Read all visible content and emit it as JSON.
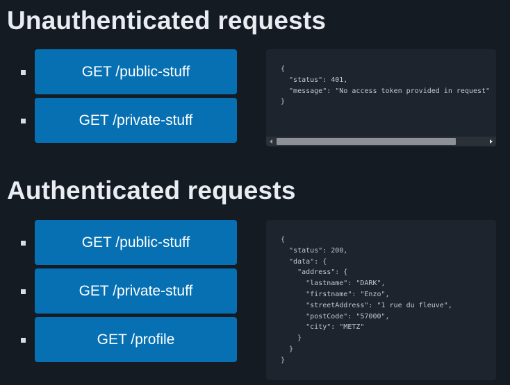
{
  "sections": {
    "unauthenticated": {
      "title": "Unauthenticated requests",
      "buttons": [
        {
          "label": "GET /public-stuff"
        },
        {
          "label": "GET /private-stuff"
        }
      ],
      "response": "{\n  \"status\": 401,\n  \"message\": \"No access token provided in request\"\n}"
    },
    "authenticated": {
      "title": "Authenticated requests",
      "buttons": [
        {
          "label": "GET /public-stuff"
        },
        {
          "label": "GET /private-stuff"
        },
        {
          "label": "GET /profile"
        }
      ],
      "response": "{\n  \"status\": 200,\n  \"data\": {\n    \"address\": {\n      \"lastname\": \"DARK\",\n      \"firstname\": \"Enzo\",\n      \"streetAddress\": \"1 rue du fleuve\",\n      \"postCode\": \"57000\",\n      \"city\": \"METZ\"\n    }\n  }\n}"
    }
  },
  "colors": {
    "background": "#151b23",
    "button": "#0670b3",
    "code_panel": "#1e242d"
  },
  "icons": [
    "scroll-left-arrow-icon",
    "scroll-right-arrow-icon"
  ]
}
